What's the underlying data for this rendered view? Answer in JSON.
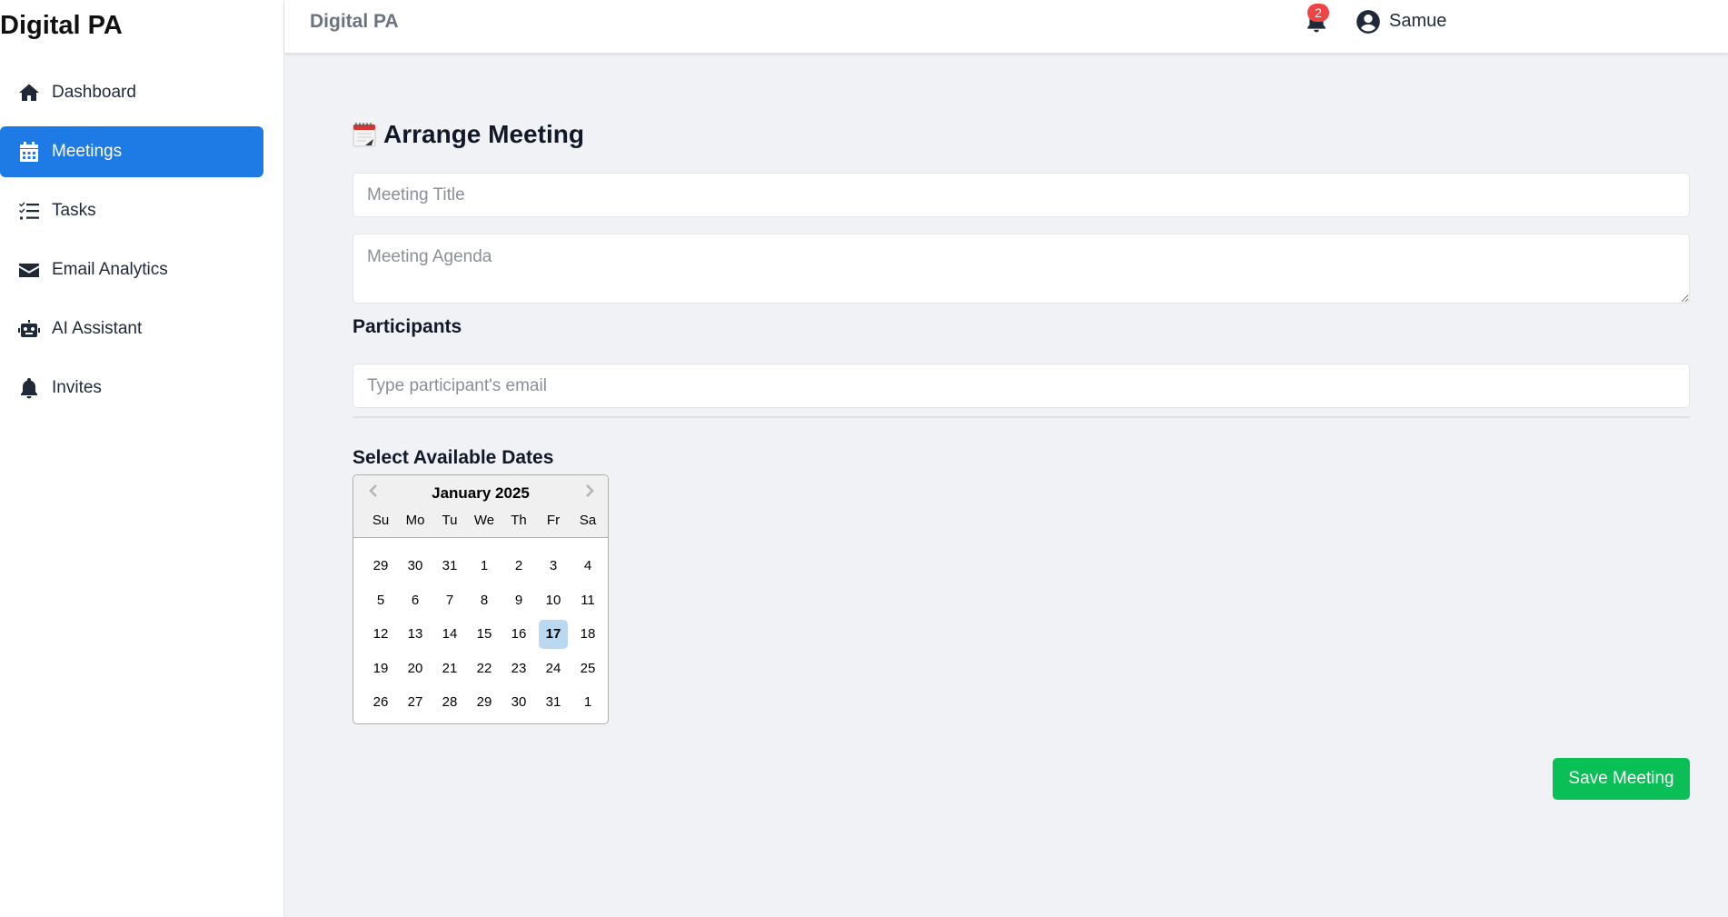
{
  "app": {
    "brand": "Digital PA",
    "header_title": "Digital PA"
  },
  "sidebar": {
    "items": [
      {
        "label": "Dashboard",
        "icon": "home-icon",
        "active": false
      },
      {
        "label": "Meetings",
        "icon": "calendar-icon",
        "active": true
      },
      {
        "label": "Tasks",
        "icon": "task-list-icon",
        "active": false
      },
      {
        "label": "Email Analytics",
        "icon": "envelope-icon",
        "active": false
      },
      {
        "label": "AI Assistant",
        "icon": "robot-icon",
        "active": false
      },
      {
        "label": "Invites",
        "icon": "bell-icon",
        "active": false
      }
    ]
  },
  "header": {
    "notification_count": "2",
    "user_name": "Samue"
  },
  "form": {
    "title": "Arrange Meeting",
    "title_placeholder": "Meeting Title",
    "title_value": "",
    "agenda_placeholder": "Meeting Agenda",
    "agenda_value": "",
    "participants_label": "Participants",
    "email_placeholder": "Type participant's email",
    "email_value": "",
    "dates_label": "Select Available Dates",
    "save_label": "Save Meeting"
  },
  "calendar": {
    "month_label": "January 2025",
    "weekdays": [
      "Su",
      "Mo",
      "Tu",
      "We",
      "Th",
      "Fr",
      "Sa"
    ],
    "weeks": [
      [
        "29",
        "30",
        "31",
        "1",
        "2",
        "3",
        "4"
      ],
      [
        "5",
        "6",
        "7",
        "8",
        "9",
        "10",
        "11"
      ],
      [
        "12",
        "13",
        "14",
        "15",
        "16",
        "17",
        "18"
      ],
      [
        "19",
        "20",
        "21",
        "22",
        "23",
        "24",
        "25"
      ],
      [
        "26",
        "27",
        "28",
        "29",
        "30",
        "31",
        "1"
      ]
    ],
    "selected": "17"
  },
  "colors": {
    "primary": "#1e7be6",
    "success": "#0bbf57",
    "badge": "#ef4444",
    "selected_day": "#bad9f1"
  }
}
